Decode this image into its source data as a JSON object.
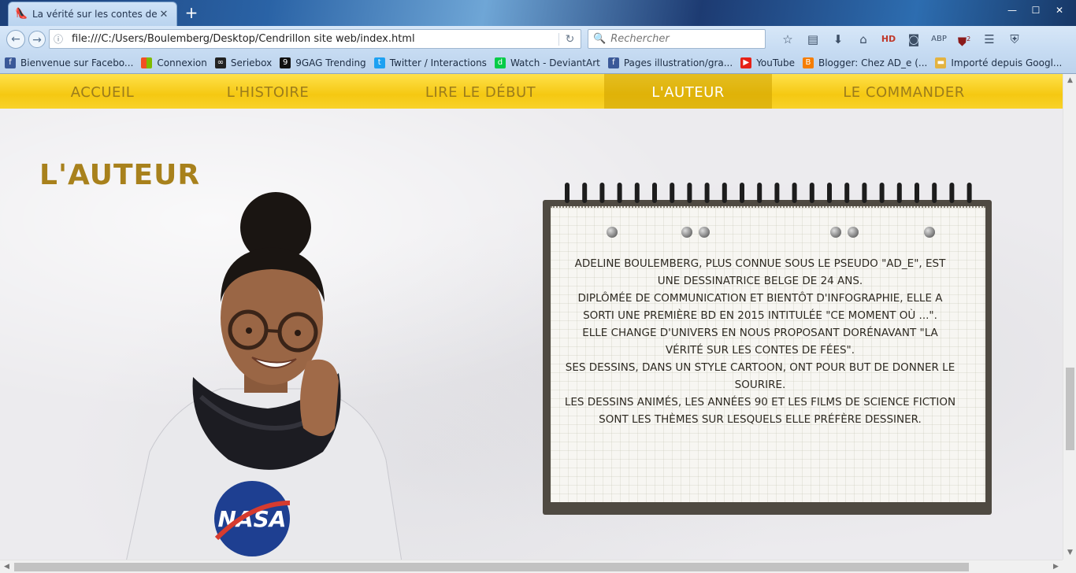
{
  "browser": {
    "tab_title": "La vérité sur les contes de...",
    "url": "file:///C:/Users/Boulemberg/Desktop/Cendrillon site web/index.html",
    "search_placeholder": "Rechercher",
    "badge_count": "2",
    "bookmarks": [
      {
        "label": "Bienvenue sur Facebo...",
        "icon": "facebook-icon",
        "color": "#3b5998"
      },
      {
        "label": "Connexion",
        "icon": "microsoft-icon",
        "color": "#e04b1c"
      },
      {
        "label": "Seriebox",
        "icon": "seriebox-icon",
        "color": "#222222"
      },
      {
        "label": "9GAG Trending",
        "icon": "9gag-icon",
        "color": "#111111"
      },
      {
        "label": "Twitter / Interactions",
        "icon": "twitter-icon",
        "color": "#1da1f2"
      },
      {
        "label": "Watch - DeviantArt",
        "icon": "deviantart-icon",
        "color": "#05cc47"
      },
      {
        "label": "Pages illustration/gra...",
        "icon": "facebook-icon",
        "color": "#3b5998"
      },
      {
        "label": "YouTube",
        "icon": "youtube-icon",
        "color": "#e62117"
      },
      {
        "label": "Blogger: Chez AD_e (...",
        "icon": "blogger-icon",
        "color": "#f57d00"
      },
      {
        "label": "Importé depuis Googl...",
        "icon": "folder-icon",
        "color": "#e3b341"
      }
    ]
  },
  "site": {
    "menu": [
      {
        "label": "ACCUEIL",
        "active": false
      },
      {
        "label": "L'HISTOIRE",
        "active": false
      },
      {
        "label": "LIRE LE DÉBUT",
        "active": false
      },
      {
        "label": "L'AUTEUR",
        "active": true
      },
      {
        "label": "LE COMMANDER",
        "active": false
      }
    ],
    "page_title": "L'AUTEUR",
    "portrait_text": "NASA",
    "bio": [
      "Adeline Boulemberg, plus connue sous le pseudo \"AD_e\", est une dessinatrice belge de 24 ans.",
      "Diplômée de communication et bientôt d'infographie, elle a sorti une première BD en 2015 intitulée \"Ce moment où ...\".",
      "Elle change d'univers en nous proposant dorénavant \"La vérité sur les contes de fées\".",
      "Ses dessins, dans un style cartoon, ont pour but de donner le sourire.",
      "Les dessins animés, les années 90 et les films de science fiction sont les thèmes sur lesquels elle préfère dessiner."
    ]
  },
  "colors": {
    "menu_yellow": "#f5c812",
    "title_gold": "#a8811c",
    "menu_text": "#9b7c1c"
  }
}
